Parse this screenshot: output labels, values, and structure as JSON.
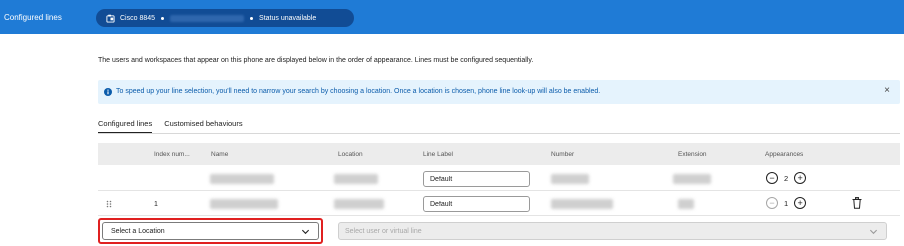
{
  "header": {
    "title": "Configured lines",
    "device_model": "Cisco 8845",
    "status": "Status unavailable"
  },
  "intro_text": "The users and workspaces that appear on this phone are displayed below in the order of appearance. Lines must be configured sequentially.",
  "banner": {
    "text": "To speed up your line selection, you'll need to narrow your search by choosing a location. Once a location is chosen, phone line look-up will also be enabled.",
    "close_label": "×"
  },
  "tabs": [
    {
      "label": "Configured lines",
      "active": true
    },
    {
      "label": "Customised behaviours",
      "active": false
    }
  ],
  "table": {
    "columns": [
      "Index num...",
      "Name",
      "Location",
      "Line Label",
      "Number",
      "Extension",
      "Appearances"
    ],
    "rows": [
      {
        "index": "",
        "line_label": "Default",
        "appearances": "2",
        "minus_disabled": false
      },
      {
        "index": "1",
        "line_label": "Default",
        "appearances": "1",
        "minus_disabled": true
      }
    ]
  },
  "location_select": {
    "value": "Select a Location"
  },
  "user_select": {
    "placeholder": "Select user or virtual line"
  },
  "colors": {
    "header_bg": "#1f7bd6",
    "pill_bg": "#114c95",
    "banner_bg": "#e5f3fd",
    "highlight": "#e02020"
  }
}
